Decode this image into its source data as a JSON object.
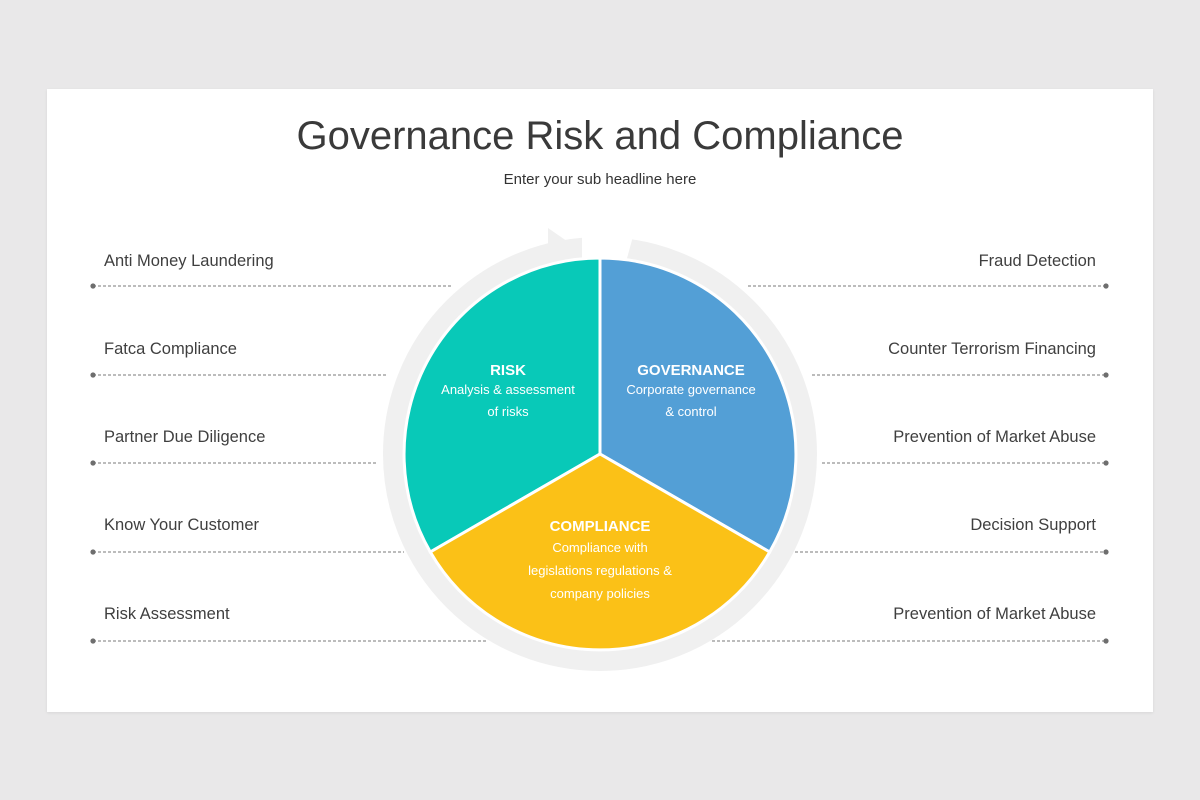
{
  "title": "Governance Risk and Compliance",
  "subtitle": "Enter your sub headline here",
  "left_items": [
    "Anti Money Laundering",
    "Fatca Compliance",
    "Partner Due Diligence",
    "Know Your Customer",
    "Risk Assessment"
  ],
  "right_items": [
    "Fraud Detection",
    "Counter Terrorism Financing",
    "Prevention of Market Abuse",
    "Decision Support",
    "Prevention of Market Abuse"
  ],
  "segments": {
    "risk": {
      "title": "RISK",
      "line1": "Analysis & assessment",
      "line2": "of risks",
      "color": "#08c9b8"
    },
    "governance": {
      "title": "GOVERNANCE",
      "line1": "Corporate governance",
      "line2": "& control",
      "color": "#539fd6"
    },
    "compliance": {
      "title": "COMPLIANCE",
      "line1": "Compliance with",
      "line2": "legislations regulations &",
      "line3": "company policies",
      "color": "#fbc117"
    }
  },
  "colors": {
    "ring": "#f0f0f0",
    "text": "#3f3f3f",
    "leader": "#7a7a7a"
  }
}
